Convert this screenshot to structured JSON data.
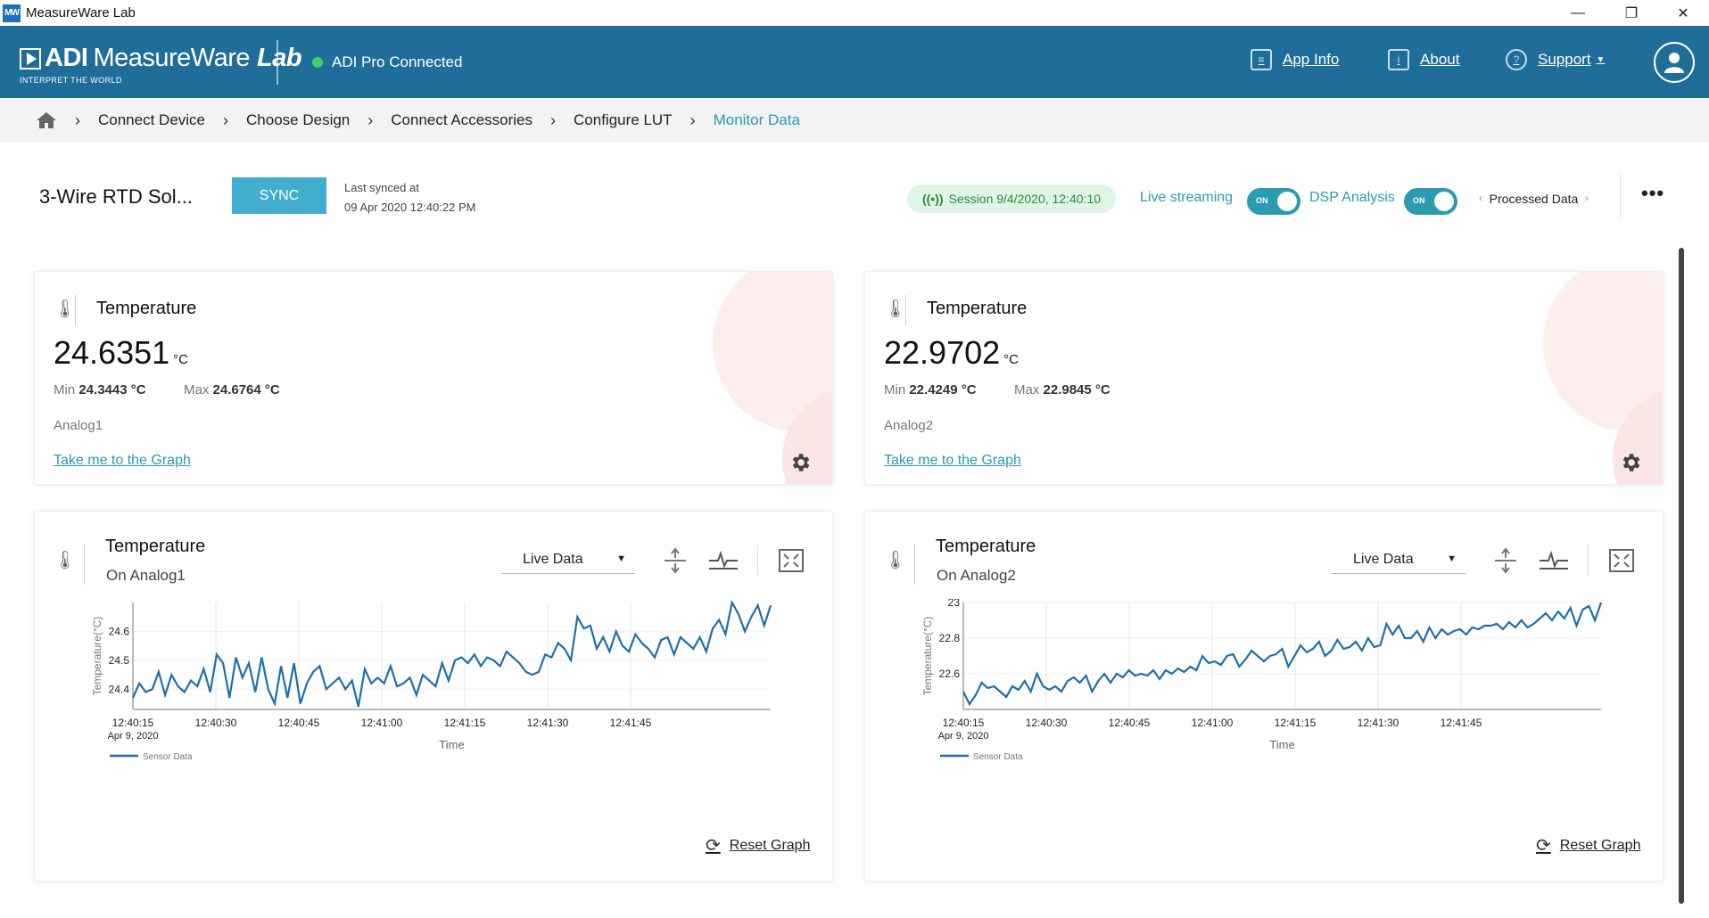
{
  "window": {
    "app_icon": "MW",
    "title": "MeasureWare Lab",
    "minimize": "—",
    "restore": "❐",
    "close": "✕"
  },
  "header": {
    "brand_a": "ADI",
    "brand_b": "MeasureWare",
    "brand_c": "Lab",
    "tagline": "INTERPRET THE WORLD",
    "connection": "ADI Pro Connected",
    "connection_color": "#3fcf6b",
    "links": {
      "app_info": "App Info",
      "about": "About",
      "support": "Support"
    }
  },
  "breadcrumb": {
    "items": [
      "Connect Device",
      "Choose Design",
      "Connect Accessories",
      "Configure LUT",
      "Monitor Data"
    ],
    "active": "Monitor Data"
  },
  "toolbar": {
    "device_title": "3-Wire RTD Sol...",
    "sync_label": "SYNC",
    "last_synced_label": "Last synced at",
    "last_synced_value": "09 Apr 2020 12:40:22 PM",
    "session": "Session 9/4/2020, 12:40:10",
    "live_streaming_label": "Live streaming",
    "live_streaming_state": "ON",
    "dsp_label": "DSP Analysis",
    "dsp_state": "ON",
    "processed_data": "Processed Data",
    "accent": "#2a9bb1"
  },
  "readings": [
    {
      "title": "Temperature",
      "value": "24.6351",
      "unit": "°C",
      "min_label": "Min",
      "min": "24.3443 °C",
      "max_label": "Max",
      "max": "24.6764 °C",
      "channel": "Analog1",
      "link": "Take me to the Graph"
    },
    {
      "title": "Temperature",
      "value": "22.9702",
      "unit": "°C",
      "min_label": "Min",
      "min": "22.4249 °C",
      "max_label": "Max",
      "max": "22.9845 °C",
      "channel": "Analog2",
      "link": "Take me to the Graph"
    }
  ],
  "charts": [
    {
      "title": "Temperature",
      "subtitle": "On Analog1",
      "mode": "Live Data",
      "reset": "Reset Graph"
    },
    {
      "title": "Temperature",
      "subtitle": "On Analog2",
      "mode": "Live Data",
      "reset": "Reset Graph"
    }
  ],
  "chart_data": [
    {
      "type": "line",
      "ylabel": "Temperature(°C)",
      "xlabel": "Time",
      "x_ticks": [
        "12:40:15",
        "12:40:30",
        "12:40:45",
        "12:41:00",
        "12:41:15",
        "12:41:30",
        "12:41:45"
      ],
      "x_first_date": "Apr 9, 2020",
      "y_ticks": [
        24.4,
        24.5,
        24.6
      ],
      "ylim": [
        24.33,
        24.7
      ],
      "xlim": [
        0,
        99
      ],
      "legend_placement": "bottom-left",
      "series": [
        {
          "name": "Sensor Data",
          "color": "#1f6fa8",
          "values": [
            24.37,
            24.42,
            24.39,
            24.4,
            24.46,
            24.38,
            24.45,
            24.41,
            24.39,
            24.43,
            24.41,
            24.47,
            24.39,
            24.52,
            24.49,
            24.37,
            24.51,
            24.44,
            24.49,
            24.39,
            24.51,
            24.4,
            24.35,
            24.48,
            24.37,
            24.49,
            24.35,
            24.42,
            24.46,
            24.48,
            24.4,
            24.42,
            24.44,
            24.4,
            24.43,
            24.34,
            24.47,
            24.42,
            24.44,
            24.42,
            24.48,
            24.41,
            24.42,
            24.44,
            24.38,
            24.45,
            24.43,
            24.41,
            24.49,
            24.43,
            24.5,
            24.51,
            24.49,
            24.52,
            24.48,
            24.51,
            24.5,
            24.48,
            24.53,
            24.51,
            24.49,
            24.46,
            24.45,
            24.46,
            24.52,
            24.51,
            24.56,
            24.54,
            24.5,
            24.65,
            24.61,
            24.62,
            24.54,
            24.58,
            24.53,
            24.6,
            24.55,
            24.53,
            24.59,
            24.56,
            24.54,
            24.51,
            24.57,
            24.58,
            24.52,
            24.58,
            24.56,
            24.54,
            24.58,
            24.53,
            24.61,
            24.64,
            24.59,
            24.7,
            24.66,
            24.6,
            24.65,
            24.69,
            24.62,
            24.69
          ]
        }
      ]
    },
    {
      "type": "line",
      "ylabel": "Temperature(°C)",
      "xlabel": "Time",
      "x_ticks": [
        "12:40:15",
        "12:40:30",
        "12:40:45",
        "12:41:00",
        "12:41:15",
        "12:41:30",
        "12:41:45"
      ],
      "x_first_date": "Apr 9, 2020",
      "y_ticks": [
        22.6,
        22.8,
        23
      ],
      "ylim": [
        22.4,
        23.0
      ],
      "xlim": [
        0,
        99
      ],
      "legend_placement": "bottom-left",
      "series": [
        {
          "name": "Sensor Data",
          "color": "#1f6fa8",
          "values": [
            22.5,
            22.43,
            22.48,
            22.55,
            22.52,
            22.53,
            22.5,
            22.47,
            22.53,
            22.51,
            22.56,
            22.5,
            22.6,
            22.53,
            22.51,
            22.53,
            22.5,
            22.56,
            22.58,
            22.55,
            22.59,
            22.5,
            22.56,
            22.6,
            22.55,
            22.6,
            22.58,
            22.62,
            22.59,
            22.6,
            22.59,
            22.62,
            22.57,
            22.62,
            22.6,
            22.63,
            22.61,
            22.64,
            22.62,
            22.7,
            22.66,
            22.67,
            22.65,
            22.7,
            22.71,
            22.64,
            22.68,
            22.73,
            22.7,
            22.67,
            22.7,
            22.71,
            22.74,
            22.64,
            22.7,
            22.76,
            22.72,
            22.74,
            22.78,
            22.7,
            22.73,
            22.79,
            22.74,
            22.75,
            22.78,
            22.73,
            22.8,
            22.75,
            22.76,
            22.88,
            22.82,
            22.87,
            22.8,
            22.8,
            22.84,
            22.78,
            22.86,
            22.8,
            22.85,
            22.82,
            22.84,
            22.85,
            22.82,
            22.86,
            22.85,
            22.87,
            22.87,
            22.88,
            22.85,
            22.89,
            22.86,
            22.9,
            22.86,
            22.88,
            22.91,
            22.94,
            22.9,
            22.95,
            22.91,
            22.97,
            22.87,
            22.96,
            22.98,
            22.9,
            23.0
          ]
        }
      ]
    }
  ]
}
